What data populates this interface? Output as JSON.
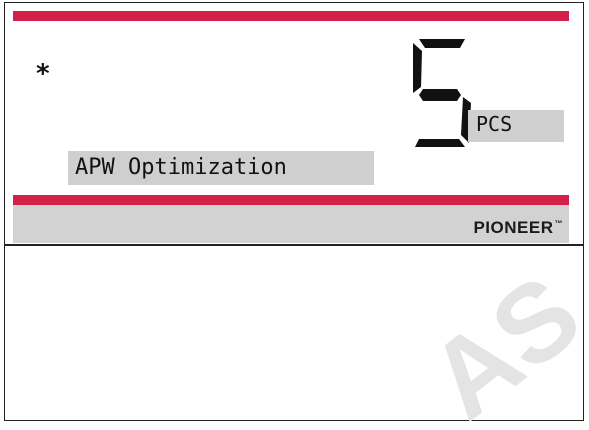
{
  "display": {
    "status_symbol": "*",
    "main_value": "5",
    "unit": "PCS",
    "message": "APW Optimization"
  },
  "brand": {
    "name": "PIONEER",
    "trademark": "™"
  },
  "watermark": {
    "text": "AS"
  },
  "colors": {
    "accent_red": "#d4214a",
    "panel_gray": "#cfcfcf",
    "band_gray": "#d2d2d2"
  }
}
